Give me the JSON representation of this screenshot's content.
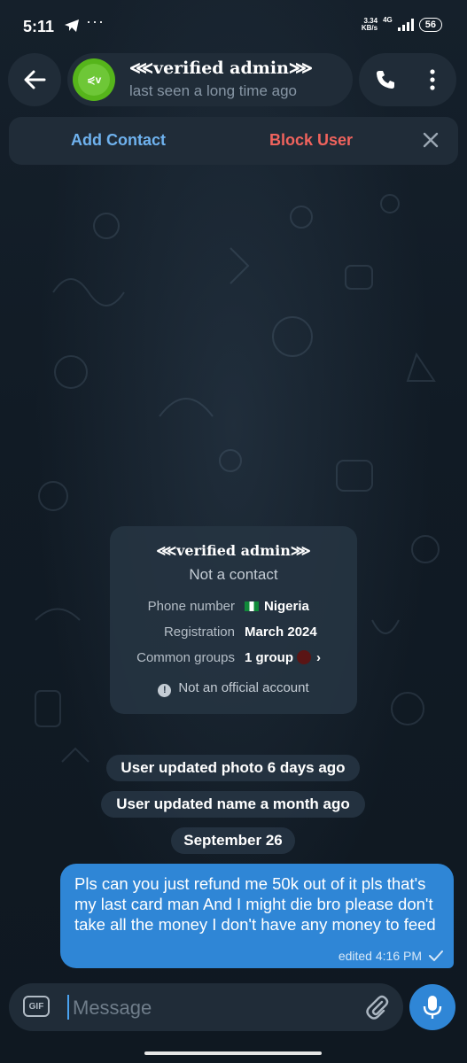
{
  "statusbar": {
    "time": "5:11",
    "net_speed_top": "3.34",
    "net_speed_bottom": "KB/s",
    "net_gen": "4G",
    "battery": "56"
  },
  "header": {
    "name": "⋘verified admin⋙",
    "status": "last seen a long time ago",
    "avatar_text": "⋞v"
  },
  "actions": {
    "add_contact": "Add Contact",
    "block_user": "Block User"
  },
  "info": {
    "name": "⋘verified admin⋙",
    "subtitle": "Not a contact",
    "rows": [
      {
        "label": "Phone number",
        "value": "Nigeria"
      },
      {
        "label": "Registration",
        "value": "March 2024"
      },
      {
        "label": "Common groups",
        "value": "1 group"
      }
    ],
    "official": "Not an official account"
  },
  "service": [
    "User updated photo 6 days ago",
    "User updated name a month ago",
    "September 26"
  ],
  "message": {
    "text": "Pls can you just refund me 50k out of it pls that's my last card man And I might die bro please don't take all the money I don't have any money to feed",
    "meta": "edited 4:16 PM"
  },
  "input": {
    "placeholder": "Message",
    "gif_label": "GIF"
  },
  "colors": {
    "accent": "#2f86d6",
    "block": "#f0635d",
    "link": "#6fb2ee",
    "avatar": "#56b51b"
  }
}
